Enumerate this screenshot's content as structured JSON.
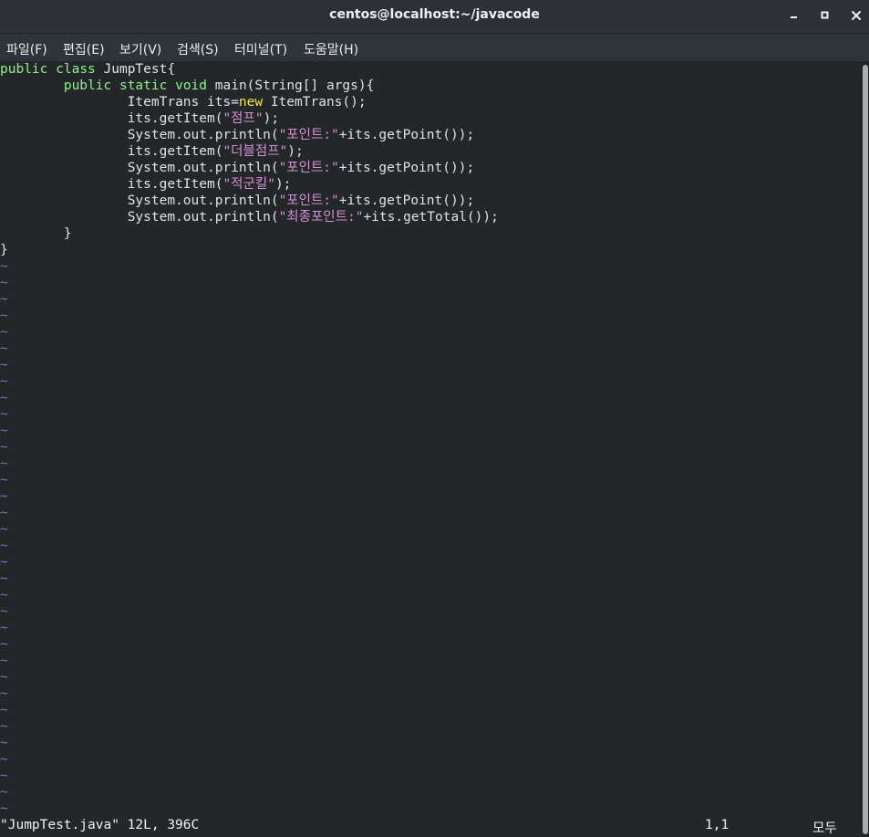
{
  "window": {
    "title": "centos@localhost:~/javacode"
  },
  "menu": {
    "items": [
      "파일(F)",
      "편집(E)",
      "보기(V)",
      "검색(S)",
      "터미널(T)",
      "도움말(H)"
    ]
  },
  "code": {
    "line1": {
      "keyword1": "public",
      "keyword2": "class",
      "rest": "JumpTest{"
    },
    "line2": {
      "indent": "        ",
      "keyword1": "public",
      "keyword2": "static",
      "keyword3": "void",
      "rest": "main(String[] args){"
    },
    "line3": {
      "indent": "                ",
      "prefix": "ItemTrans its=",
      "keyword": "new",
      "suffix": " ItemTrans();"
    },
    "line4": {
      "indent": "                ",
      "prefix": "its.getItem(",
      "string": "\"점프\"",
      "suffix": ");"
    },
    "line5": {
      "indent": "                ",
      "prefix": "System.out.println(",
      "string": "\"포인트:\"",
      "suffix": "+its.getPoint());"
    },
    "line6": {
      "indent": "                ",
      "prefix": "its.getItem(",
      "string": "\"더블점프\"",
      "suffix": ");"
    },
    "line7": {
      "indent": "                ",
      "prefix": "System.out.println(",
      "string": "\"포인트:\"",
      "suffix": "+its.getPoint());"
    },
    "line8": {
      "indent": "                ",
      "prefix": "its.getItem(",
      "string": "\"적군킬\"",
      "suffix": ");"
    },
    "line9": {
      "indent": "                ",
      "prefix": "System.out.println(",
      "string": "\"포인트:\"",
      "suffix": "+its.getPoint());"
    },
    "line10": {
      "indent": "                ",
      "prefix": "System.out.println(",
      "string": "\"최종포인트:\"",
      "suffix": "+its.getTotal());"
    },
    "line11": "        }",
    "line12": "}",
    "tilde": "~"
  },
  "status": {
    "file": "\"JumpTest.java\" 12L, 396C",
    "position": "1,1",
    "scroll": "모두"
  },
  "colors": {
    "keyword": "#90f090",
    "new_keyword": "#f7e44a",
    "string": "#d58fd4",
    "tilde": "#6f74c7",
    "text": "#e0e2e4",
    "background": "#24272a"
  },
  "icons": {
    "minimize": "minimize-icon",
    "maximize": "maximize-icon",
    "close": "close-icon"
  }
}
